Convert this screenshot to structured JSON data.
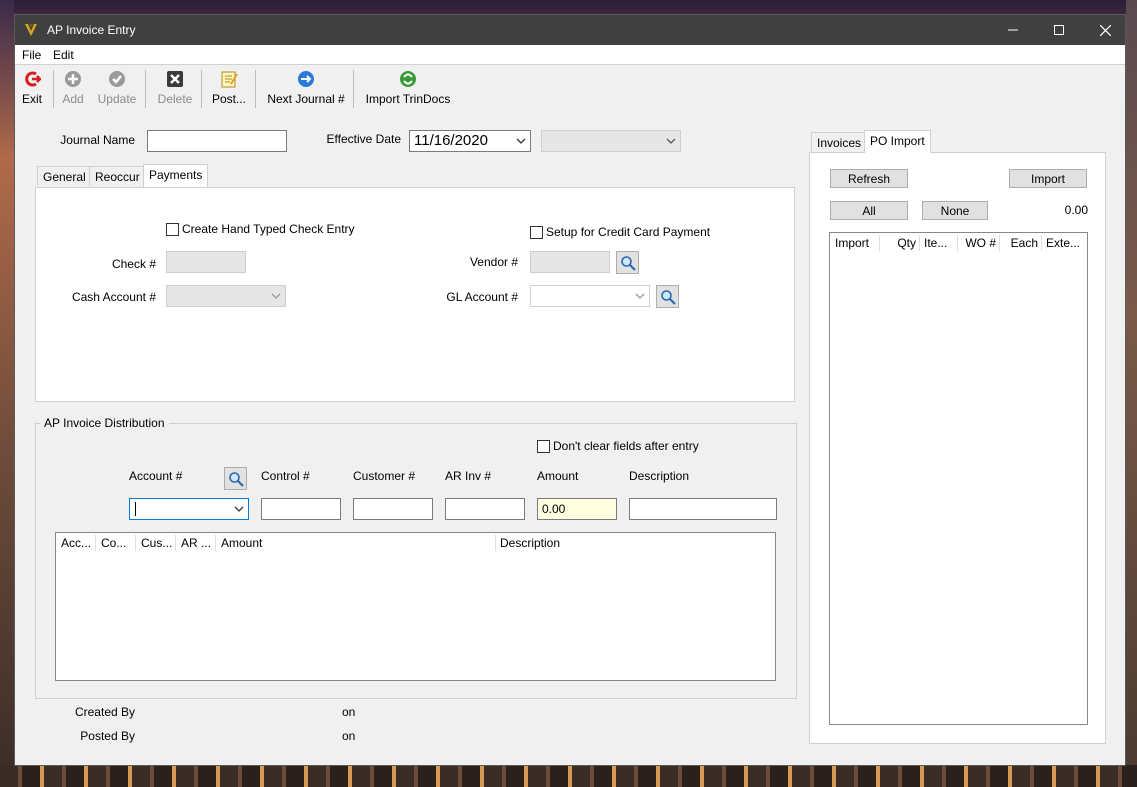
{
  "window": {
    "title": "AP Invoice Entry"
  },
  "menu": {
    "file": "File",
    "edit": "Edit"
  },
  "toolbar": {
    "exit": "Exit",
    "add": "Add",
    "update": "Update",
    "delete": "Delete",
    "post": "Post...",
    "next_journal": "Next Journal #",
    "import_trindocs": "Import TrinDocs"
  },
  "header": {
    "journal_name_label": "Journal Name",
    "journal_name_value": "",
    "effective_date_label": "Effective Date",
    "effective_date_value": "11/16/2020",
    "extra_combo_value": ""
  },
  "left_tabs": {
    "general": "General",
    "reoccur": "Reoccur",
    "payments": "Payments",
    "active": "Payments"
  },
  "payments": {
    "hand_check_label": "Create Hand Typed Check Entry",
    "hand_check_checked": false,
    "credit_card_label": "Setup for Credit Card Payment",
    "credit_card_checked": false,
    "check_no_label": "Check #",
    "check_no_value": "",
    "vendor_label": "Vendor #",
    "vendor_value": "",
    "cash_account_label": "Cash Account #",
    "cash_account_value": "",
    "gl_account_label": "GL Account #",
    "gl_account_value": ""
  },
  "distribution": {
    "title": "AP Invoice Distribution",
    "dont_clear_label": "Don't clear fields after entry",
    "dont_clear_checked": false,
    "account_label": "Account #",
    "control_label": "Control #",
    "customer_label": "Customer #",
    "ar_inv_label": "AR Inv #",
    "amount_label": "Amount",
    "description_label": "Description",
    "account_value": "",
    "control_value": "",
    "customer_value": "",
    "ar_inv_value": "",
    "amount_value": "0.00",
    "description_value": "",
    "columns": [
      "Acc...",
      "Co...",
      "Cus...",
      "AR ...",
      "Amount",
      "Description"
    ],
    "rows": []
  },
  "footer": {
    "created_by_label": "Created By",
    "created_on_label": "on",
    "posted_by_label": "Posted By",
    "posted_on_label": "on"
  },
  "right_tabs": {
    "invoices": "Invoices",
    "po_import": "PO Import",
    "active": "PO Import"
  },
  "po_import": {
    "refresh": "Refresh",
    "import": "Import",
    "all": "All",
    "none": "None",
    "total": "0.00",
    "columns": [
      "Import",
      "Qty",
      "Ite...",
      "WO #",
      "Each",
      "Exte..."
    ],
    "rows": []
  },
  "colors": {
    "titlebar": "#404040",
    "amount_bg": "#ffffe1",
    "focus_border": "#0078d7"
  }
}
